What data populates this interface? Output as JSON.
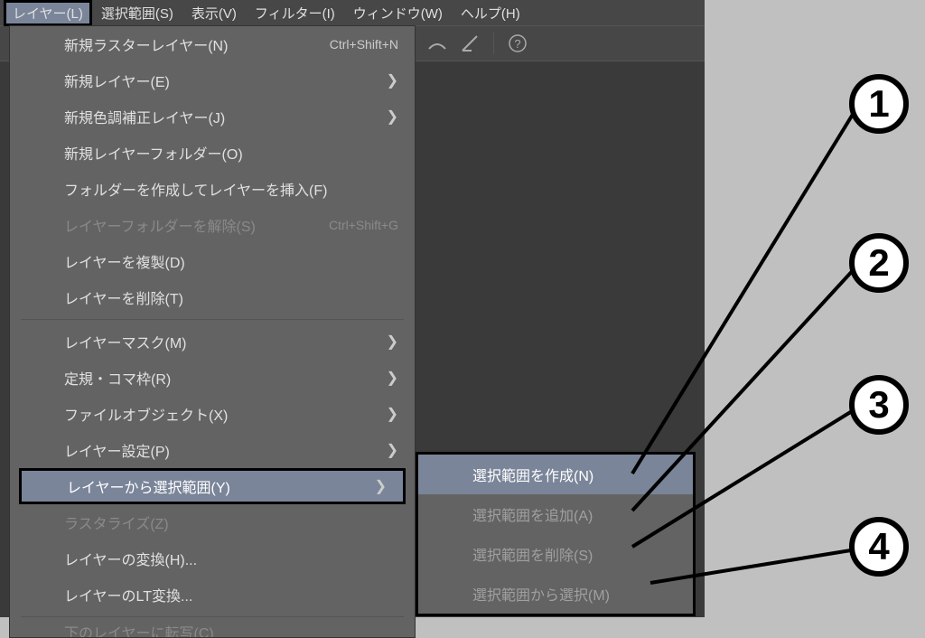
{
  "menubar": {
    "layer": "レイヤー(L)",
    "selection": "選択範囲(S)",
    "view": "表示(V)",
    "filter": "フィルター(I)",
    "window": "ウィンドウ(W)",
    "help": "ヘルプ(H)"
  },
  "dropdown": {
    "new_raster": "新規ラスターレイヤー(N)",
    "new_raster_shortcut": "Ctrl+Shift+N",
    "new_layer": "新規レイヤー(E)",
    "new_tone": "新規色調補正レイヤー(J)",
    "new_folder": "新規レイヤーフォルダー(O)",
    "create_folder_insert": "フォルダーを作成してレイヤーを挿入(F)",
    "release_folder": "レイヤーフォルダーを解除(S)",
    "release_folder_shortcut": "Ctrl+Shift+G",
    "duplicate": "レイヤーを複製(D)",
    "delete": "レイヤーを削除(T)",
    "mask": "レイヤーマスク(M)",
    "ruler_frame": "定規・コマ枠(R)",
    "file_object": "ファイルオブジェクト(X)",
    "settings": "レイヤー設定(P)",
    "layer_to_selection": "レイヤーから選択範囲(Y)",
    "rasterize": "ラスタライズ(Z)",
    "convert": "レイヤーの変換(H)...",
    "lt_convert": "レイヤーのLT変換...",
    "bottom_cut": "下のレイヤーに転写(C)"
  },
  "submenu": {
    "create": "選択範囲を作成(N)",
    "add": "選択範囲を追加(A)",
    "delete": "選択範囲を削除(S)",
    "from_selection": "選択範囲から選択(M)"
  },
  "callouts": {
    "c1": "1",
    "c2": "2",
    "c3": "3",
    "c4": "4"
  },
  "chevron": "❯"
}
